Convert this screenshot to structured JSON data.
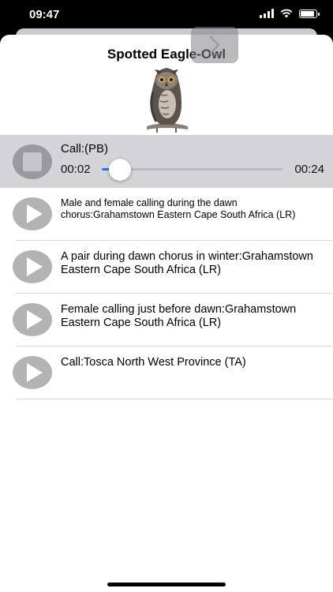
{
  "status": {
    "time": "09:47"
  },
  "title": "Spotted Eagle-Owl",
  "now_playing": {
    "label": "Call:(PB)",
    "elapsed": "00:02",
    "total": "00:24",
    "progress": 0.1
  },
  "tracks": [
    {
      "label": "Male and female calling during the dawn chorus:Grahamstown  Eastern Cape  South Africa (LR)"
    },
    {
      "label": "A pair during dawn chorus in winter:Grahamstown  Eastern Cape  South Africa (LR)"
    },
    {
      "label": "Female calling just before dawn:Grahamstown  Eastern Cape  South Africa (LR)"
    },
    {
      "label": "Call:Tosca  North West Province (TA)"
    }
  ],
  "colors": {
    "accent": "#2a6ef0",
    "playing_bg": "#d4d4d8",
    "button_gray": "#b3b3b6"
  },
  "icons": {
    "next": "chevron-right-icon",
    "stop": "stop-icon",
    "play": "play-icon"
  }
}
